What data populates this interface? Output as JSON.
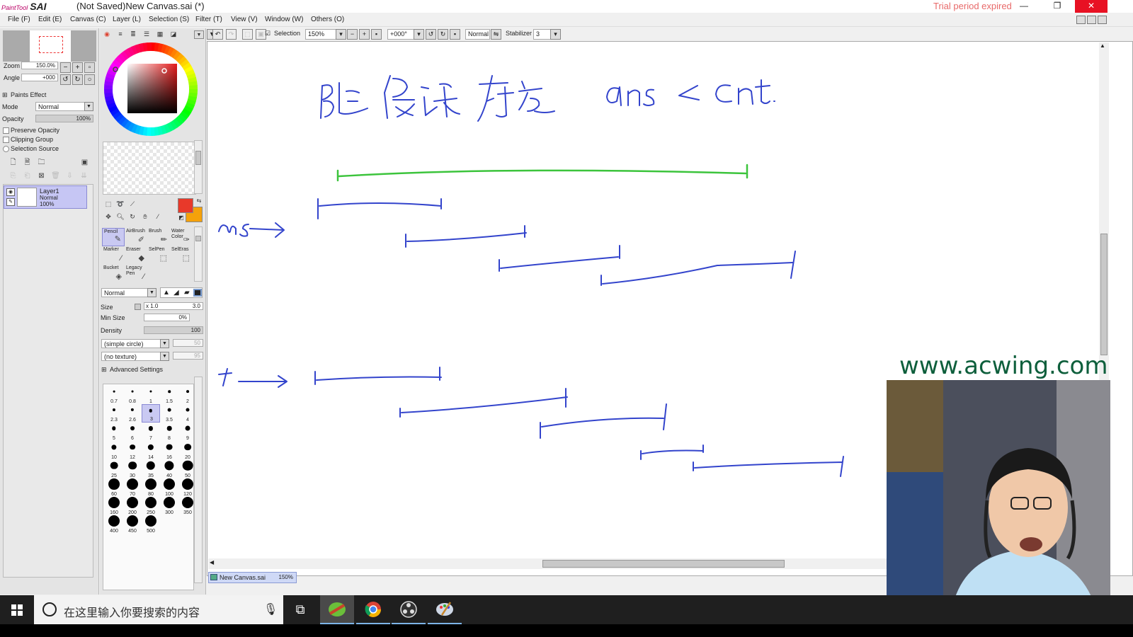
{
  "titlebar": {
    "app_small": "PaintTool",
    "app_name": "SAI",
    "title": "(Not Saved)New Canvas.sai (*)",
    "trial": "Trial period expired",
    "minimize": "—",
    "restore": "❐",
    "close": "✕"
  },
  "menu": [
    "File (F)",
    "Edit (E)",
    "Canvas (C)",
    "Layer (L)",
    "Selection (S)",
    "Filter (T)",
    "View (V)",
    "Window (W)",
    "Others (O)"
  ],
  "navigator": {
    "zoom_label": "Zoom",
    "zoom_value": "150.0%",
    "angle_label": "Angle",
    "angle_value": "+000"
  },
  "layer_panel": {
    "paints_effect": "Paints Effect",
    "mode_label": "Mode",
    "mode_value": "Normal",
    "opacity_label": "Opacity",
    "opacity_value": "100%",
    "preserve_opacity": "Preserve Opacity",
    "clipping_group": "Clipping Group",
    "selection_source": "Selection Source",
    "layer": {
      "name": "Layer1",
      "mode": "Normal",
      "opacity": "100%"
    }
  },
  "tools": {
    "brushes": [
      {
        "label": "Pencil",
        "selected": true
      },
      {
        "label": "AirBrush",
        "selected": false
      },
      {
        "label": "Brush",
        "selected": false
      },
      {
        "label": "Water Color",
        "selected": false
      },
      {
        "label": "Marker",
        "selected": false
      },
      {
        "label": "Eraser",
        "selected": false
      },
      {
        "label": "SelPen",
        "selected": false
      },
      {
        "label": "SelEras",
        "selected": false
      },
      {
        "label": "Bucket",
        "selected": false
      },
      {
        "label": "Legacy Pen",
        "selected": false
      }
    ],
    "blend_mode": "Normal",
    "size_label": "Size",
    "size_mult": "x 1.0",
    "size_value": "3.0",
    "min_size_label": "Min Size",
    "min_size_value": "0%",
    "density_label": "Density",
    "density_value": "100",
    "shape": "(simple circle)",
    "shape_value": "50",
    "texture": "(no texture)",
    "texture_value": "95",
    "advanced": "Advanced Settings",
    "brush_sizes": [
      "0.7",
      "0.8",
      "1",
      "1.5",
      "2",
      "2.3",
      "2.6",
      "3",
      "3.5",
      "4",
      "5",
      "6",
      "7",
      "8",
      "9",
      "10",
      "12",
      "14",
      "16",
      "20",
      "25",
      "30",
      "35",
      "40",
      "50",
      "60",
      "70",
      "80",
      "100",
      "120",
      "160",
      "200",
      "250",
      "300",
      "350",
      "400",
      "450",
      "500"
    ],
    "selected_size": "3",
    "primary_color": "#e8392a",
    "secondary_color": "#f5a10a"
  },
  "canvas_toolbar": {
    "selection_label": "Selection",
    "zoom": "150%",
    "angle": "+000°",
    "mode": "Normal",
    "stabilizer_label": "Stabilizer",
    "stabilizer_value": "3"
  },
  "canvas_tab": {
    "name": "New Canvas.sai",
    "zoom": "150%"
  },
  "watermark": "www.acwing.com",
  "taskbar": {
    "search_placeholder": "在这里输入你要搜索的内容"
  },
  "colors": {
    "accent": "#3344cc",
    "green_stroke": "#3cc43c",
    "close_red": "#e81123",
    "selection_purple": "#c6c6f4"
  }
}
